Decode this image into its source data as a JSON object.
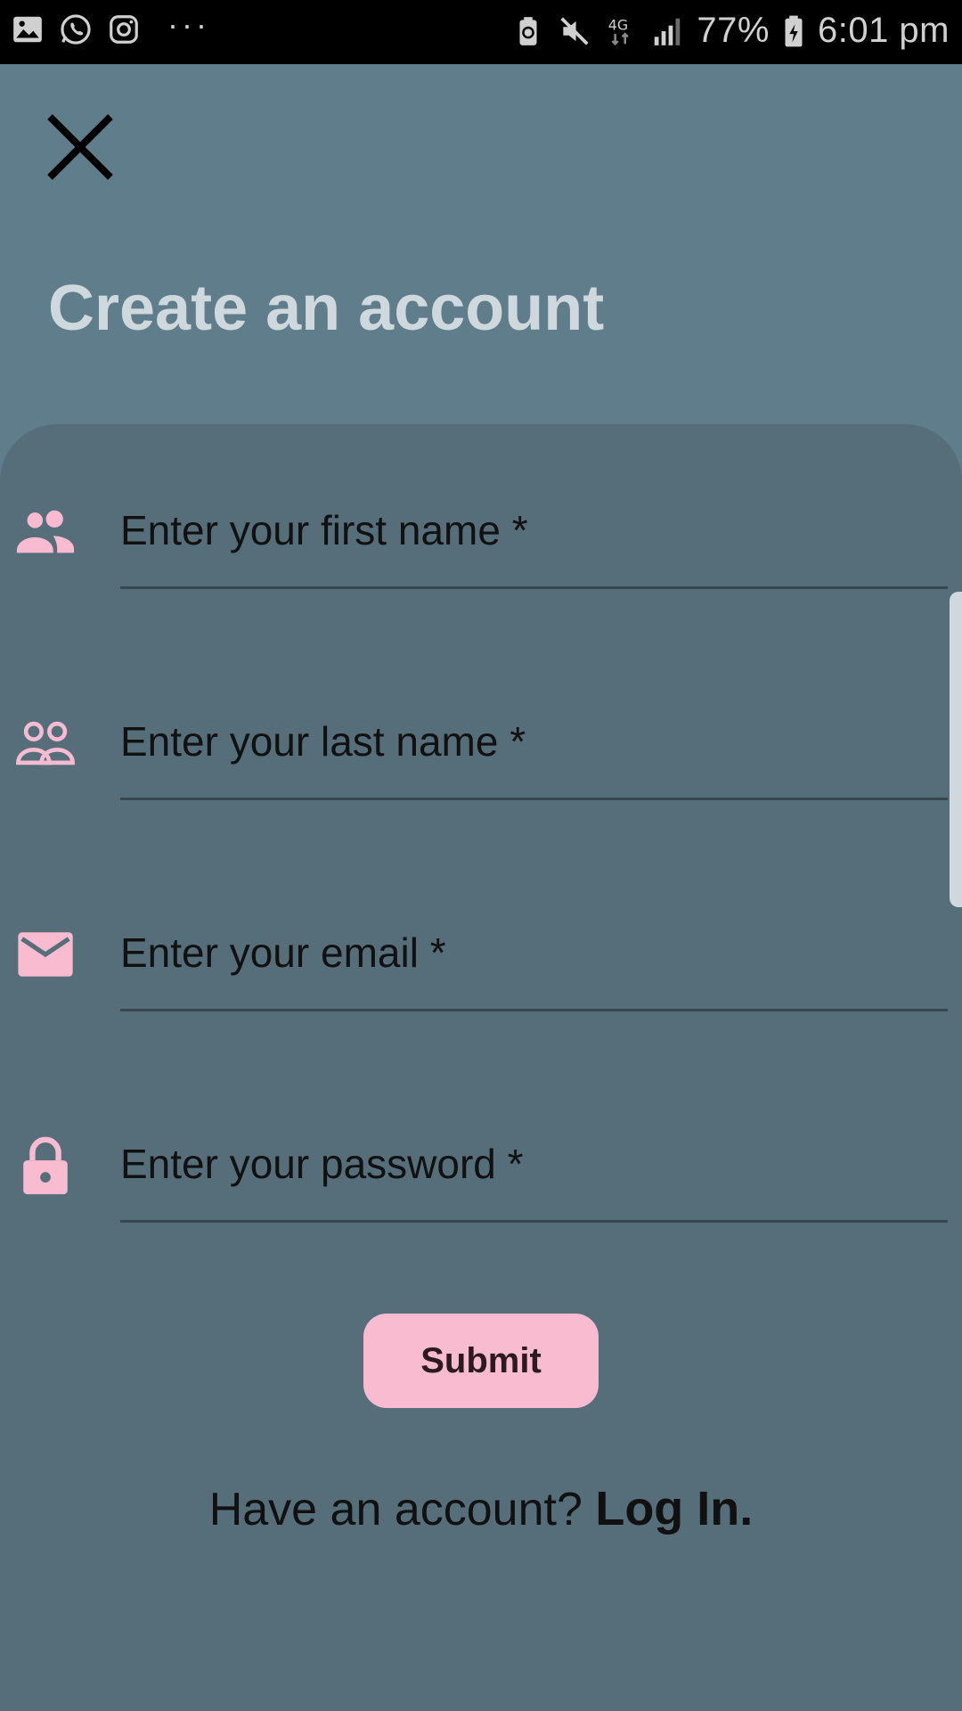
{
  "status_bar": {
    "battery_percent": "77%",
    "time": "6:01 pm",
    "network": "4G",
    "left_icons": [
      "gallery-icon",
      "whatsapp-icon",
      "instagram-icon"
    ],
    "overflow": "···",
    "right_icons": [
      "battery-saver-icon",
      "mute-icon",
      "data-4g-icon",
      "signal-icon",
      "battery-icon"
    ]
  },
  "header": {
    "close_icon": "close-icon",
    "title": "Create an account"
  },
  "form": {
    "fields": [
      {
        "icon": "people-icon",
        "placeholder": "Enter your first name *",
        "value": ""
      },
      {
        "icon": "people-outline-icon",
        "placeholder": "Enter your last name *",
        "value": ""
      },
      {
        "icon": "mail-icon",
        "placeholder": "Enter your email *",
        "value": ""
      },
      {
        "icon": "lock-icon",
        "placeholder": "Enter your password *",
        "value": ""
      }
    ],
    "submit_label": "Submit"
  },
  "footer": {
    "prompt": "Have an account?",
    "login_label": "Log In."
  },
  "colors": {
    "background": "#5f7d8b",
    "card": "#566e7a",
    "accent": "#f8bbd0",
    "title": "#cfd8dc"
  }
}
